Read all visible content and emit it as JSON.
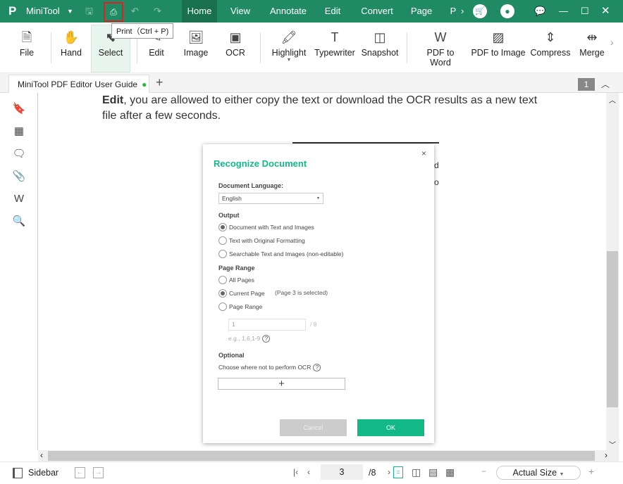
{
  "app": {
    "name": "MiniTool",
    "tooltip": "Print（Ctrl + P)"
  },
  "menu": [
    {
      "label": "Home"
    },
    {
      "label": "View"
    },
    {
      "label": "Annotate"
    },
    {
      "label": "Edit"
    },
    {
      "label": "Convert"
    },
    {
      "label": "Page"
    },
    {
      "label": "P"
    }
  ],
  "toolbar": [
    {
      "label": "File",
      "icon": "file-icon"
    },
    {
      "label": "Hand",
      "icon": "hand-icon"
    },
    {
      "label": "Select",
      "icon": "cursor-icon"
    },
    {
      "label": "Edit",
      "icon": "edit-icon"
    },
    {
      "label": "Image",
      "icon": "image-icon"
    },
    {
      "label": "OCR",
      "icon": "ocr-icon"
    },
    {
      "label": "Highlight",
      "icon": "highlight-icon"
    },
    {
      "label": "Typewriter",
      "icon": "typewriter-icon"
    },
    {
      "label": "Snapshot",
      "icon": "snapshot-icon"
    },
    {
      "label": "PDF to Word",
      "icon": "pdf-to-word-icon"
    },
    {
      "label": "PDF to Image",
      "icon": "pdf-to-image-icon"
    },
    {
      "label": "Compress",
      "icon": "compress-icon"
    },
    {
      "label": "Merge",
      "icon": "merge-icon"
    }
  ],
  "tab": {
    "title": "MiniTool PDF Editor User Guide",
    "page_badge": "1"
  },
  "doc": {
    "line1_bold": "Edit",
    "line1": ", you are allowed to either copy the text or download the OCR results as a new text",
    "line2": "file after a few seconds.",
    "frag1": "d",
    "frag2": "o"
  },
  "dialog": {
    "title": "Recognize Document",
    "language_label": "Document Language:",
    "language_value": "English",
    "output_label": "Output",
    "output_options": [
      {
        "label": "Document with Text and Images",
        "checked": true
      },
      {
        "label": "Text with Original Formatting",
        "checked": false
      },
      {
        "label": "Searchable Text and Images (non-editable)",
        "checked": false
      }
    ],
    "range_label": "Page Range",
    "range_options": [
      {
        "label": "All Pages",
        "checked": false
      },
      {
        "label": "Current Page",
        "checked": true
      },
      {
        "label": "Page Range",
        "checked": false
      }
    ],
    "current_note": "(Page 3 is selected)",
    "range_value": "1",
    "range_total": "/ 8",
    "range_hint": "e.g., 1,6,1-9",
    "optional_label": "Optional",
    "optional_text": "Choose where not to perform OCR",
    "cancel": "Cancel",
    "ok": "OK"
  },
  "status": {
    "sidebar": "Sidebar",
    "page": "3",
    "total": "/8",
    "zoom": "Actual Size"
  },
  "colors": {
    "brand": "#1f8a64",
    "accent": "#12b886"
  }
}
